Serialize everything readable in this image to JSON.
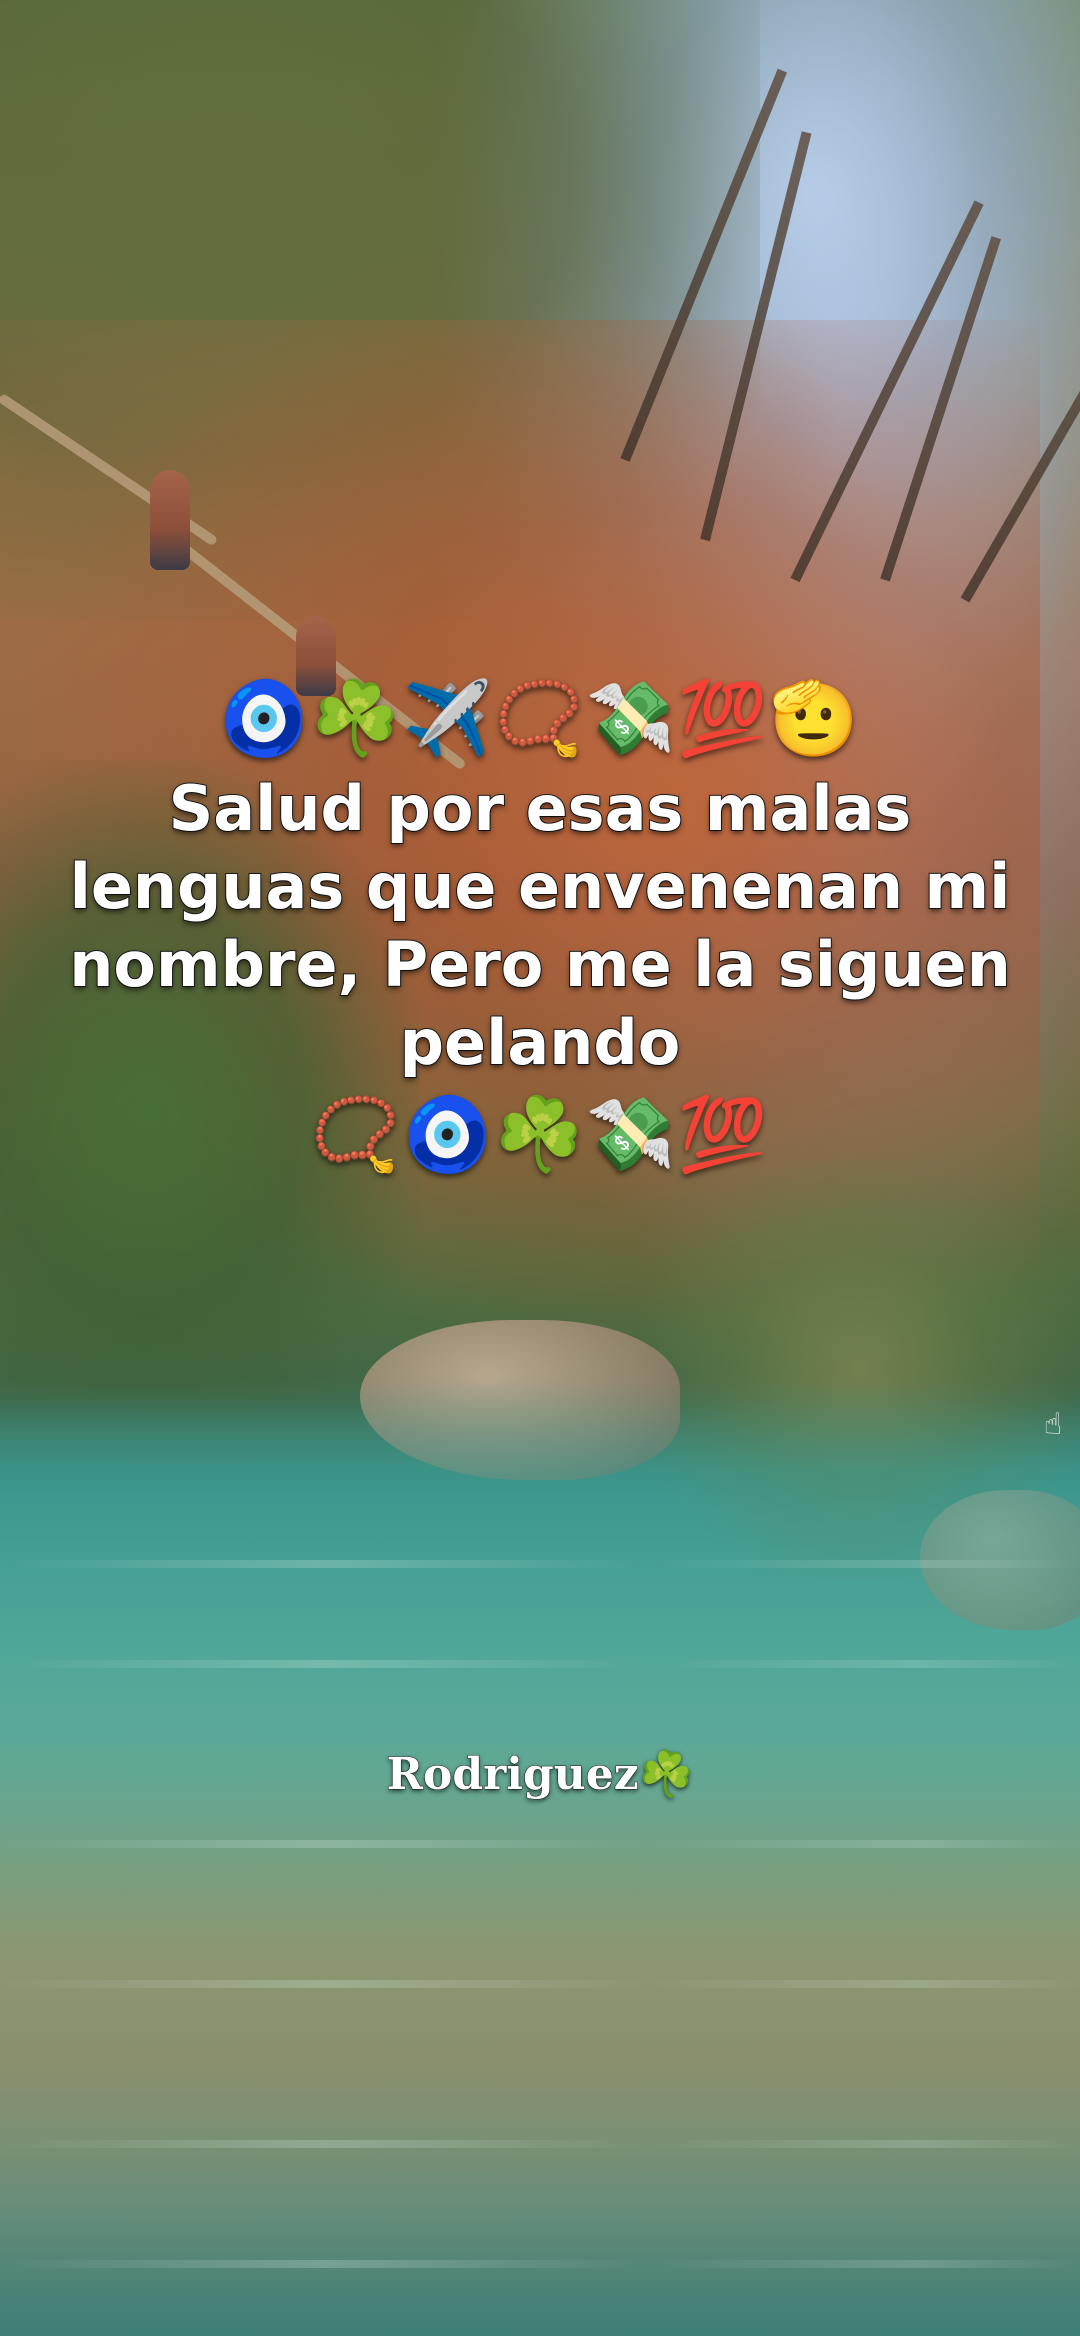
{
  "caption": {
    "emoji_top": "🧿☘️✈️📿💸💯🫡",
    "text": "Salud por esas malas lenguas que envenenan mi nombre, Pero me la siguen pelando",
    "emoji_bottom": "📿🧿☘️💸💯"
  },
  "watermark": {
    "text": "Rodriguez☘️"
  },
  "colors": {
    "caption_text": "#ffffff",
    "caption_outline": "#1a1a1a",
    "water": "#4ea59a",
    "cliff": "#c46234"
  },
  "icons": {
    "corner_hint": "white-hand-icon"
  }
}
